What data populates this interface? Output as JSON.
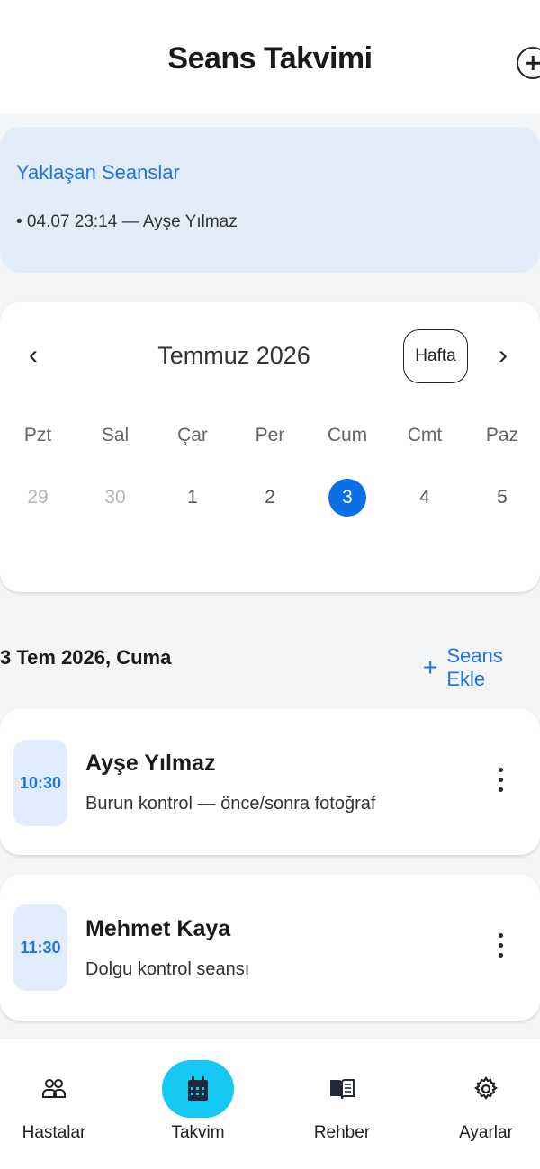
{
  "header": {
    "title": "Seans Takvimi"
  },
  "upcoming": {
    "title": "Yaklaşan Seanslar",
    "items": [
      "• 04.07 23:14 — Ayşe Yılmaz"
    ]
  },
  "calendar": {
    "prev": "‹",
    "next": "›",
    "month": "Temmuz 2026",
    "view_toggle": "Hafta",
    "weekdays": [
      "Pzt",
      "Sal",
      "Çar",
      "Per",
      "Cum",
      "Cmt",
      "Paz"
    ],
    "days": [
      "29",
      "30",
      "1",
      "2",
      "3",
      "4",
      "5"
    ],
    "selected_index": 4
  },
  "day": {
    "heading": "3 Tem 2026, Cuma",
    "add_label": "Seans Ekle"
  },
  "sessions": [
    {
      "time": "10:30",
      "name": "Ayşe Yılmaz",
      "desc": "Burun kontrol — önce/sonra fotoğraf"
    },
    {
      "time": "11:30",
      "name": "Mehmet Kaya",
      "desc": "Dolgu kontrol seansı"
    }
  ],
  "bottom_nav": [
    {
      "label": "Hastalar",
      "icon": "people-icon"
    },
    {
      "label": "Takvim",
      "icon": "calendar-icon",
      "active": true
    },
    {
      "label": "Rehber",
      "icon": "book-icon"
    },
    {
      "label": "Ayarlar",
      "icon": "gear-icon"
    }
  ],
  "colors": {
    "accent": "#1f73e6",
    "selected_day": "#0b6fe6",
    "active_nav": "#15c8f4",
    "upcoming_bg": "#e3edf9"
  }
}
